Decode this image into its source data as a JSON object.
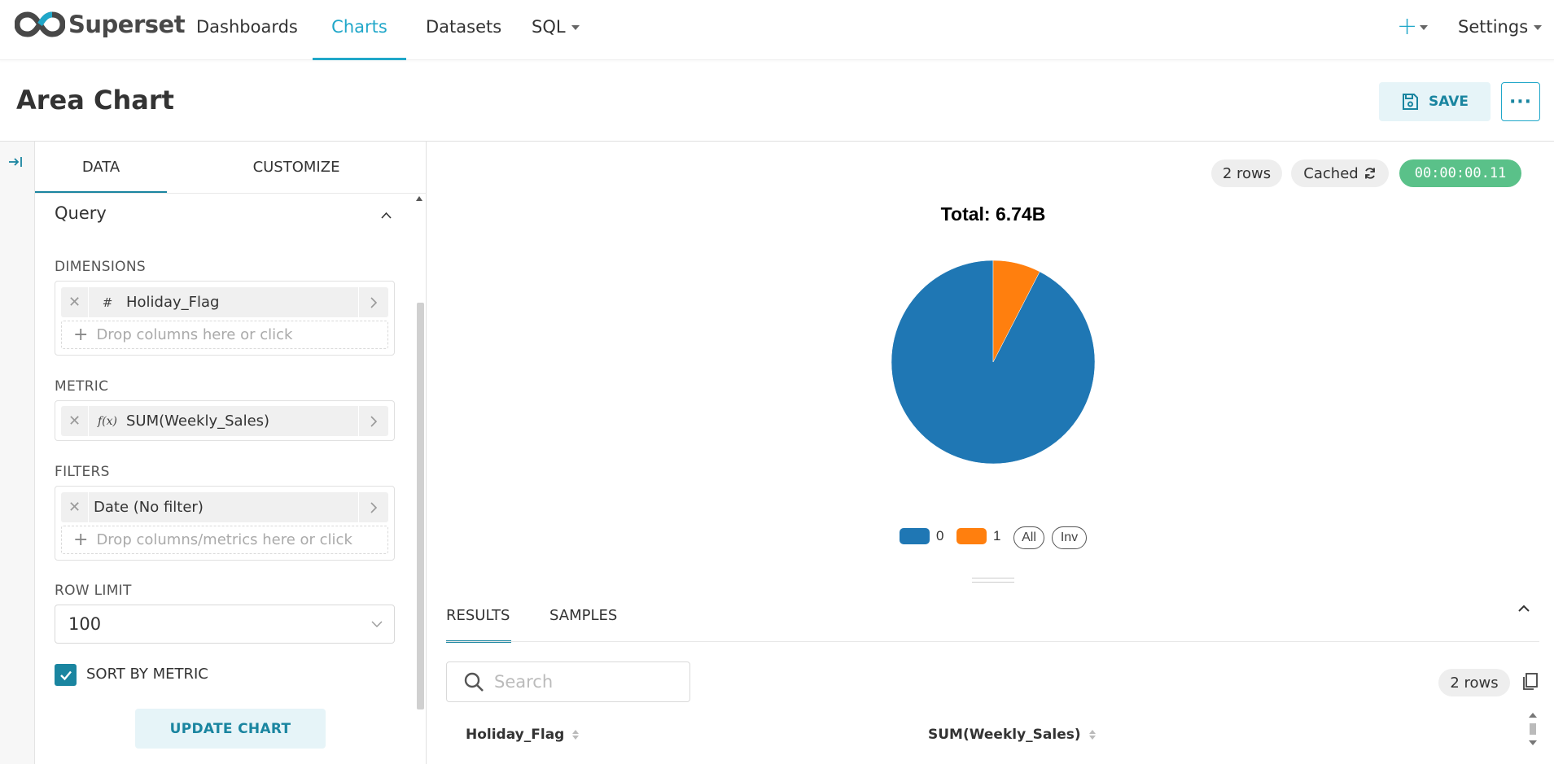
{
  "brand": {
    "name": "Superset"
  },
  "nav": {
    "items": [
      {
        "label": "Dashboards"
      },
      {
        "label": "Charts"
      },
      {
        "label": "Datasets"
      },
      {
        "label": "SQL"
      }
    ],
    "active": "Charts",
    "settings_label": "Settings",
    "plus_icon": "plus-icon"
  },
  "header": {
    "title": "Area Chart",
    "save_label": "SAVE",
    "more_label": "···"
  },
  "control_panel": {
    "tabs": [
      {
        "label": "DATA"
      },
      {
        "label": "CUSTOMIZE"
      }
    ],
    "section_title": "Query",
    "dimensions": {
      "label": "DIMENSIONS",
      "items": [
        {
          "label": "Holiday_Flag",
          "type_icon": "#"
        }
      ],
      "placeholder": "Drop columns here or click"
    },
    "metric": {
      "label": "METRIC",
      "items": [
        {
          "label": "SUM(Weekly_Sales)",
          "type_icon": "f(x)"
        }
      ]
    },
    "filters": {
      "label": "FILTERS",
      "items": [
        {
          "label": "Date (No filter)"
        }
      ],
      "placeholder": "Drop columns/metrics here or click"
    },
    "row_limit": {
      "label": "ROW LIMIT",
      "value": "100"
    },
    "sort_by_metric": {
      "label": "SORT BY METRIC",
      "checked": true
    },
    "update_label": "UPDATE CHART"
  },
  "status": {
    "rows": "2 rows",
    "cached": "Cached",
    "timer": "00:00:00.11"
  },
  "chart_data": {
    "type": "pie",
    "title": "Total: 6.74B",
    "categories": [
      "0",
      "1"
    ],
    "values": [
      6.23,
      0.51
    ],
    "colors": [
      "#1f77b4",
      "#ff7f0e"
    ],
    "legend": {
      "placement": "bottom",
      "extra_buttons": [
        "All",
        "Inv"
      ]
    }
  },
  "results": {
    "tabs": [
      {
        "label": "RESULTS"
      },
      {
        "label": "SAMPLES"
      }
    ],
    "search_placeholder": "Search",
    "row_count": "2 rows",
    "columns": [
      {
        "label": "Holiday_Flag"
      },
      {
        "label": "SUM(Weekly_Sales)"
      }
    ]
  }
}
